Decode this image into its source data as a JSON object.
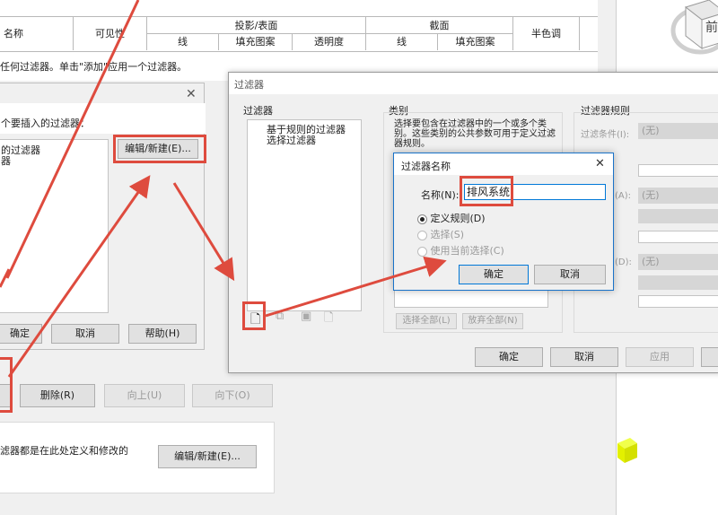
{
  "main_table": {
    "col_name": "名称",
    "col_visible": "可见性",
    "group_projection": "投影/表面",
    "group_cut": "截面",
    "col_halftone": "半色调",
    "sub_line": "线",
    "sub_fill": "填充图案",
    "sub_transparency": "透明度",
    "sub_cut_line": "线",
    "sub_cut_fill": "填充图案",
    "info_text": "任何过滤器。单击\"添加\"应用一个过滤器。"
  },
  "main_buttons": {
    "delete": "删除(R)",
    "up": "向上(U)",
    "down": "向下(O)",
    "bottom_note": "滤器都是在此处定义和修改的",
    "edit_new": "编辑/新建(E)..."
  },
  "add_dialog": {
    "prompt": "个要插入的过滤器：",
    "item1": "的过滤器",
    "item2": "器",
    "edit_new": "编辑/新建(E)...",
    "ok": "确定",
    "cancel": "取消",
    "help": "帮助(H)"
  },
  "filter_dialog": {
    "title": "过滤器",
    "filters_label": "过滤器",
    "categories_label": "类别",
    "rules_label": "过滤器规则",
    "filter_tree_1": "基于规则的过滤器",
    "filter_tree_2": "选择过滤器",
    "category_hint": "选择要包含在过滤器中的一个或多个类别。这些类别的公共参数可用于定义过滤器规则。",
    "filter_by": "过滤条件(I):",
    "none1": "(无)",
    "and1": "(A):",
    "none2": "(无)",
    "and2": "(D):",
    "none3": "(无)",
    "select_all": "选择全部(L)",
    "check_none": "放弃全部(N)",
    "ok": "确定",
    "cancel": "取消",
    "apply": "应用"
  },
  "name_dialog": {
    "title": "过滤器名称",
    "name_label": "名称(N):",
    "name_value": "排风系统",
    "option_define": "定义规则(D)",
    "option_select": "选择(S)",
    "option_current": "使用当前选择(C)",
    "ok": "确定",
    "cancel": "取消"
  },
  "viewcube": {
    "face_label": "前"
  },
  "colors": {
    "annotation_red": "#de4b3e",
    "accent_blue": "#0078d7",
    "highlight_yellow": "#e3f000"
  }
}
